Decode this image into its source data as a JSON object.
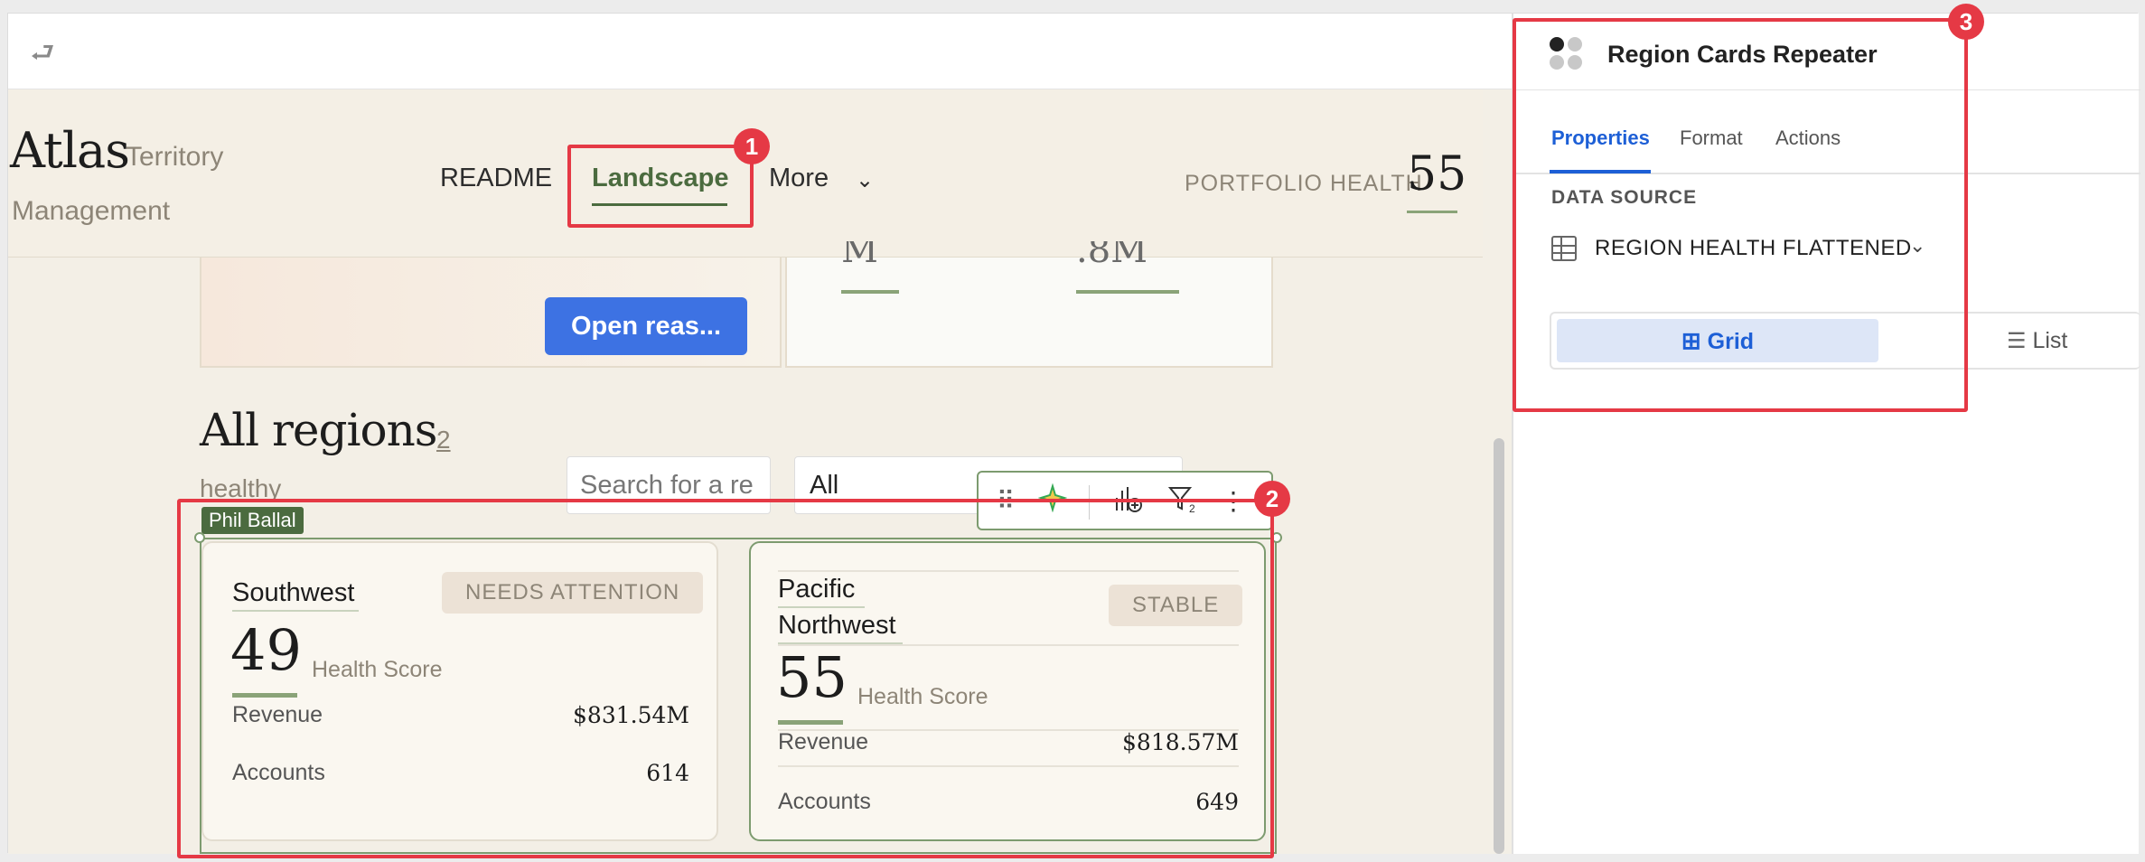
{
  "canvas": {
    "undo_icon": "undo-arrow-icon"
  },
  "app": {
    "brand": "Atlas",
    "brand_sub_1": "Territory",
    "brand_sub_2": "Management",
    "nav": {
      "readme": "README",
      "landscape": "Landscape",
      "more": "More"
    },
    "portfolio_label": "PORTFOLIO HEALTH",
    "portfolio_value": "55"
  },
  "hero": {
    "open_button": "Open reas...",
    "stat_1": "M",
    "stat_2": ".8M"
  },
  "regions": {
    "title": "All regions",
    "count": "2",
    "healthy": "healthy",
    "search_placeholder": "Search for a re",
    "filter_value": "All",
    "user_tag": "Phil Ballal"
  },
  "cards": [
    {
      "name": "Southwest",
      "badge": "NEEDS ATTENTION",
      "score": "49",
      "score_label": "Health Score",
      "revenue_label": "Revenue",
      "revenue": "$831.54M",
      "accounts_label": "Accounts",
      "accounts": "614"
    },
    {
      "name_line1": "Pacific",
      "name_line2": "Northwest",
      "badge": "STABLE",
      "score": "55",
      "score_label": "Health Score",
      "revenue_label": "Revenue",
      "revenue": "$818.57M",
      "accounts_label": "Accounts",
      "accounts": "649"
    }
  ],
  "panel": {
    "title": "Region Cards Repeater",
    "tabs": {
      "properties": "Properties",
      "format": "Format",
      "actions": "Actions"
    },
    "data_source_label": "DATA SOURCE",
    "data_source_name": "REGION HEALTH FLATTENED",
    "view_grid": "Grid",
    "view_list": "List"
  },
  "annotations": [
    "1",
    "2",
    "3"
  ],
  "colors": {
    "accent_green": "#4b6b3f",
    "accent_blue": "#1d5fd6",
    "annotation_red": "#e53945",
    "button_blue": "#3d72e3"
  }
}
